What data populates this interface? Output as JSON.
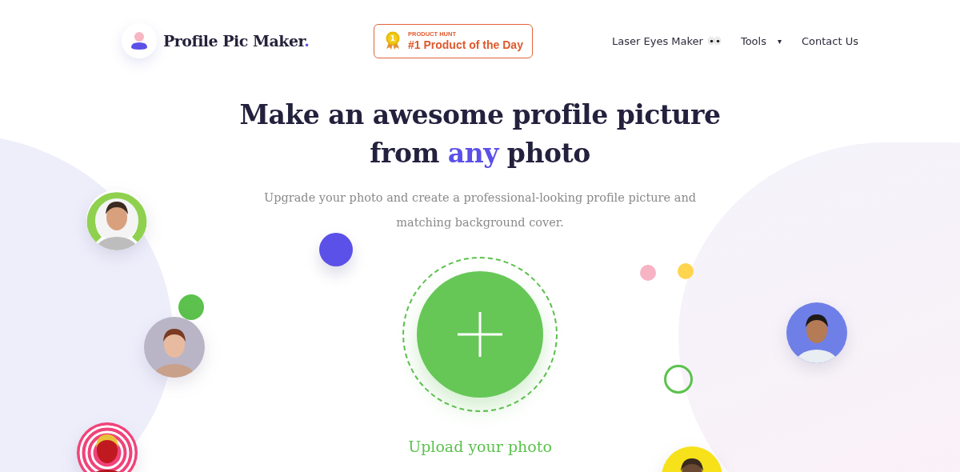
{
  "logo": {
    "text": "Profile Pic Maker",
    "dot": "."
  },
  "badge": {
    "rank": "1",
    "label": "PRODUCT HUNT",
    "title": "#1 Product of the Day"
  },
  "nav": [
    {
      "label": "Laser Eyes Maker",
      "kind": "eyes"
    },
    {
      "label": "Tools",
      "kind": "dropdown",
      "caret": "▾"
    },
    {
      "label": "Contact Us",
      "kind": "link"
    }
  ],
  "hero": {
    "title_line1": "Make an awesome profile picture",
    "title_before": "from",
    "title_highlight": "any",
    "title_after": "photo",
    "subtitle": "Upgrade your photo and create a professional-looking profile picture and matching background cover."
  },
  "upload": {
    "label": "Upload your photo"
  }
}
